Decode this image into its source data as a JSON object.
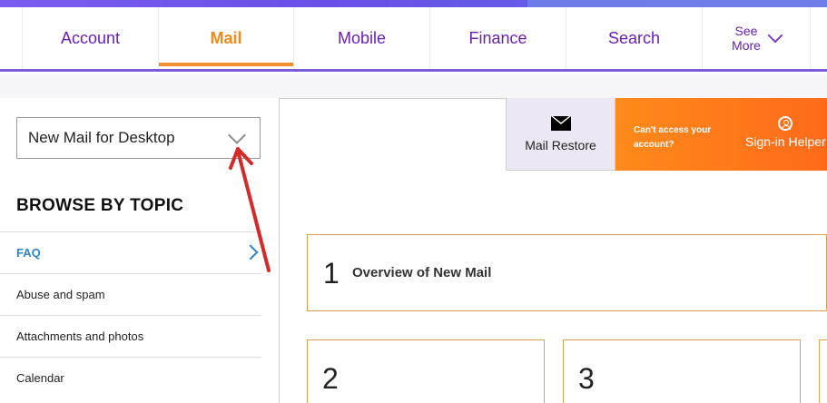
{
  "nav": {
    "tabs": [
      {
        "label": "Account"
      },
      {
        "label": "Mail"
      },
      {
        "label": "Mobile"
      },
      {
        "label": "Finance"
      },
      {
        "label": "Search"
      }
    ],
    "see_more_line1": "See",
    "see_more_line2": "More"
  },
  "sidebar": {
    "dropdown_value": "New Mail for Desktop",
    "browse_title": "BROWSE BY TOPIC",
    "topics": [
      {
        "label": "FAQ"
      },
      {
        "label": "Abuse and spam"
      },
      {
        "label": "Attachments and photos"
      },
      {
        "label": "Calendar"
      }
    ]
  },
  "actions": {
    "mail_restore_label": "Mail Restore",
    "cant_access_line1": "Can't access your",
    "cant_access_line2": "account?",
    "signin_helper_label": "Sign-in Helper"
  },
  "cards": [
    {
      "number": "1",
      "title": "Overview of New Mail"
    },
    {
      "number": "2"
    },
    {
      "number": "3"
    }
  ],
  "colors": {
    "nav_text": "#6a1fb5",
    "active_tab": "#f08a1c",
    "faq_link": "#2f86c7",
    "card_border": "#d9a24f",
    "helper_bg": "#ff7a1a",
    "annotation_arrow": "#d42a2a"
  }
}
